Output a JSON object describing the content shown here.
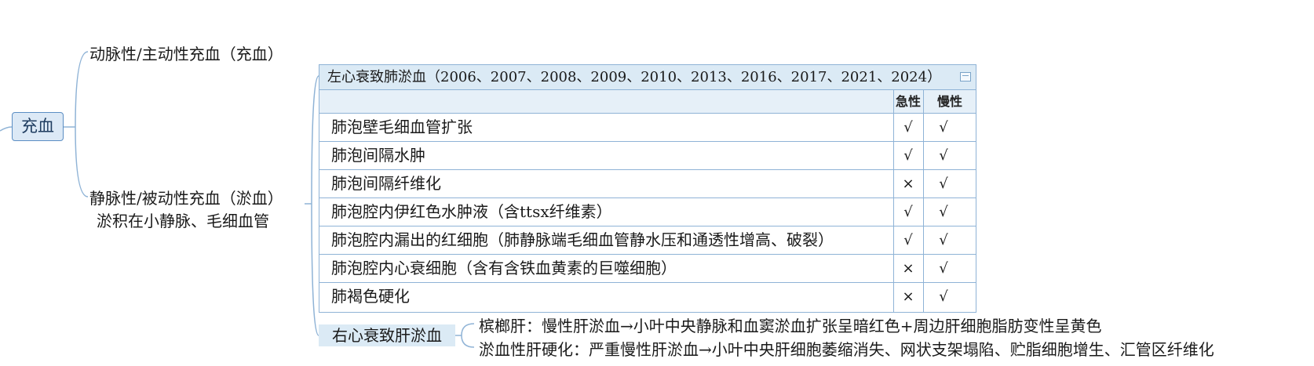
{
  "root": {
    "label": "充血"
  },
  "branches": {
    "arterial": {
      "label": "动脉性/主动性充血（充血）"
    },
    "venous": {
      "label": "静脉性/被动性充血（淤血）",
      "sublabel": "淤积在小静脉、毛细血管"
    }
  },
  "left_heart": {
    "title": "左心衰致肺淤血（2006、2007、2008、2009、2010、2013、2016、2017、2021、2024）",
    "icon": "table-icon",
    "columns": {
      "acute": "急性",
      "chronic": "慢性"
    },
    "rows": [
      {
        "name": "肺泡壁毛细血管扩张",
        "acute": "√",
        "chronic": "√"
      },
      {
        "name": "肺泡间隔水肿",
        "acute": "√",
        "chronic": "√"
      },
      {
        "name": "肺泡间隔纤维化",
        "acute": "×",
        "chronic": "√"
      },
      {
        "name": "肺泡腔内伊红色水肿液（含ttsx纤维素）",
        "acute": "√",
        "chronic": "√"
      },
      {
        "name": "肺泡腔内漏出的红细胞（肺静脉端毛细血管静水压和通透性增高、破裂）",
        "acute": "√",
        "chronic": "√"
      },
      {
        "name": "肺泡腔内心衰细胞（含有含铁血黄素的巨噬细胞）",
        "acute": "×",
        "chronic": "√"
      },
      {
        "name": "肺褐色硬化",
        "acute": "×",
        "chronic": "√"
      }
    ]
  },
  "right_heart": {
    "label": "右心衰致肝淤血",
    "items": [
      "槟榔肝：慢性肝淤血→小叶中央静脉和血窦淤血扩张呈暗红色+周边肝细胞脂肪变性呈黄色",
      "淤血性肝硬化：严重慢性肝淤血→小叶中央肝细胞萎缩消失、网状支架塌陷、贮脂细胞增生、汇管区纤维化"
    ]
  }
}
